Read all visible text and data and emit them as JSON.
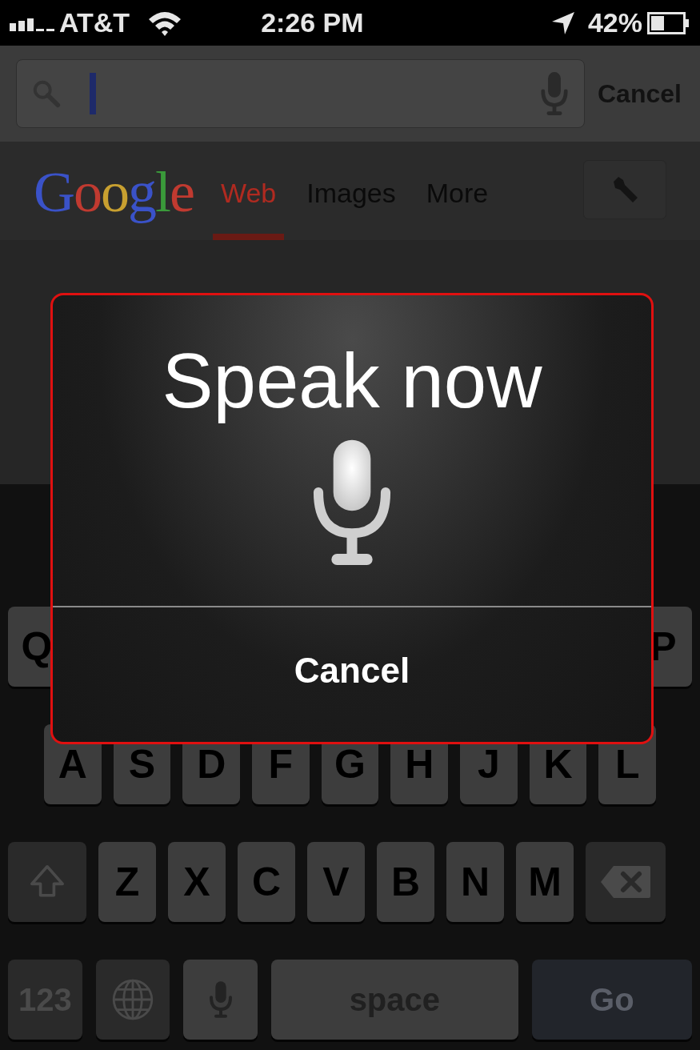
{
  "status_bar": {
    "carrier": "AT&T",
    "time": "2:26 PM",
    "battery": "42%"
  },
  "search": {
    "button": "Cancel"
  },
  "header": {
    "logo": "Google",
    "tabs": [
      {
        "label": "Web",
        "selected": true
      },
      {
        "label": "Images",
        "selected": false
      },
      {
        "label": "More",
        "selected": false
      }
    ]
  },
  "keyboard": {
    "rows": [
      {
        "keys": [
          {
            "kind": "letter",
            "label": "Q"
          },
          {
            "kind": "letter",
            "label": "P"
          }
        ]
      },
      {
        "keys": [
          {
            "kind": "letter",
            "label": "A"
          },
          {
            "kind": "letter",
            "label": "S"
          },
          {
            "kind": "letter",
            "label": "D"
          },
          {
            "kind": "letter",
            "label": "F"
          },
          {
            "kind": "letter",
            "label": "G"
          },
          {
            "kind": "letter",
            "label": "H"
          },
          {
            "kind": "letter",
            "label": "J"
          },
          {
            "kind": "letter",
            "label": "K"
          },
          {
            "kind": "letter",
            "label": "L"
          }
        ]
      },
      {
        "keys": [
          {
            "kind": "shift"
          },
          {
            "kind": "letter",
            "label": "Z"
          },
          {
            "kind": "letter",
            "label": "X"
          },
          {
            "kind": "letter",
            "label": "C"
          },
          {
            "kind": "letter",
            "label": "V"
          },
          {
            "kind": "letter",
            "label": "B"
          },
          {
            "kind": "letter",
            "label": "N"
          },
          {
            "kind": "letter",
            "label": "M"
          },
          {
            "kind": "delete"
          }
        ]
      },
      {
        "keys": [
          {
            "kind": "numbers",
            "label": "123"
          },
          {
            "kind": "globe"
          },
          {
            "kind": "mic"
          },
          {
            "kind": "space",
            "label": "space"
          },
          {
            "kind": "go",
            "label": "Go"
          }
        ]
      }
    ]
  },
  "dialog": {
    "title": "Speak now",
    "button": "Cancel"
  }
}
